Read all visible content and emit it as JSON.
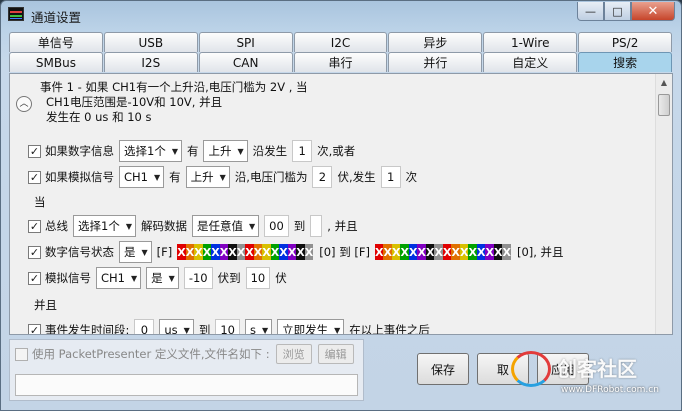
{
  "window": {
    "title": "通道设置",
    "buttons": {
      "minimize": "—",
      "maximize": "□",
      "close": "✕"
    }
  },
  "tabs": {
    "row1": [
      "单信号",
      "USB",
      "SPI",
      "I2C",
      "异步",
      "1-Wire",
      "PS/2"
    ],
    "row2": [
      "SMBus",
      "I2S",
      "CAN",
      "串行",
      "并行",
      "自定义",
      "搜索"
    ],
    "active": "搜索"
  },
  "summary": {
    "line1": "事件  1 - 如果 CH1有一个上升沿,电压门槛为 2V , 当",
    "line2": "CH1电压范围是-10V和 10V, 并且",
    "line3": "发生在 0 us 和  10 s"
  },
  "digital_row": {
    "label": "如果数字信息",
    "select_value": "选择1个",
    "has": "有",
    "edge": "上升",
    "suffix": "沿发生",
    "count": "1",
    "suffix2": "次,或者"
  },
  "analog_row": {
    "label": "如果模拟信号",
    "channel": "CH1",
    "has": "有",
    "edge": "上升",
    "mid": "沿,电压门槛为",
    "threshold": "2",
    "mid2": "伏,发生",
    "count": "1",
    "suffix": "次"
  },
  "when_label": "当",
  "bus_row": {
    "label": "总线",
    "select_value": "选择1个",
    "decode": "解码数据",
    "condition": "是任意值",
    "value_from": "00",
    "to": "到",
    "value_to": "",
    "suffix": ", 并且"
  },
  "digital_state_row": {
    "label": "数字信号状态",
    "is": "是",
    "f1": "[F]",
    "pattern": "XXXXXXXXXXXXXXXX",
    "r1": "[0] 到 [F]",
    "r2": "[0], 并且"
  },
  "analog_signal_row": {
    "label": "模拟信号",
    "channel": "CH1",
    "is": "是",
    "from": "-10",
    "mid": "伏到",
    "to": "10",
    "suffix": "伏"
  },
  "and_label": "并且",
  "time_row": {
    "label": "事件发生时间段:",
    "from": "0",
    "from_unit": "us",
    "to_word": "到",
    "to": "10",
    "to_unit": "s",
    "mode": "立即发生",
    "suffix": "在以上事件之后"
  },
  "packet_presenter": {
    "label": "使用 PacketPresenter 定义文件,文件名如下 :",
    "browse": "浏览",
    "edit": "编辑",
    "filename": ""
  },
  "actions": {
    "save": "保存",
    "cancel": "取",
    "apply": "应用"
  },
  "watermark": {
    "text": "创客社区",
    "url": "www.DFRobot.com.cn"
  },
  "colors": {
    "x_pattern": [
      "#e00000",
      "#e07000",
      "#d8c000",
      "#00a000",
      "#0030e0",
      "#8000c0",
      "#101010",
      "#909090",
      "#e00000",
      "#e07000",
      "#d8c000",
      "#00a000",
      "#0030e0",
      "#8000c0",
      "#101010",
      "#909090"
    ]
  }
}
